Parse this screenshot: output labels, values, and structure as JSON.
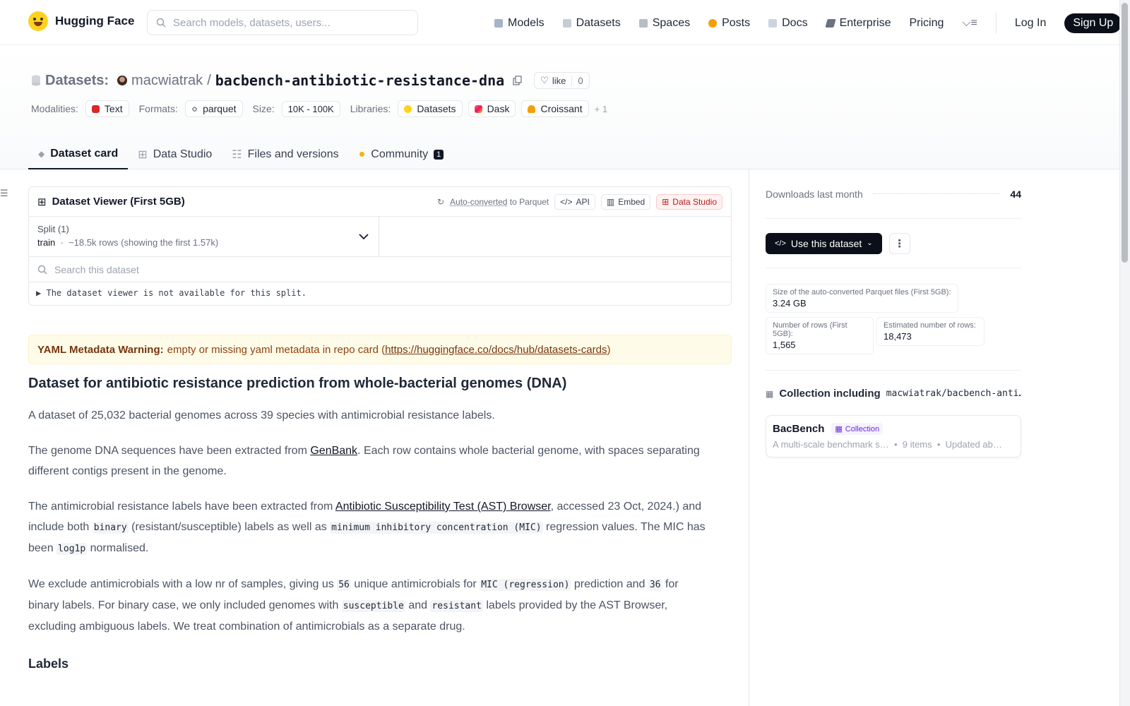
{
  "nav": {
    "brand": "Hugging Face",
    "search_placeholder": "Search models, datasets, users...",
    "links": [
      "Models",
      "Datasets",
      "Spaces",
      "Posts",
      "Docs",
      "Enterprise",
      "Pricing"
    ],
    "login": "Log In",
    "signup": "Sign Up"
  },
  "header": {
    "section_label": "Datasets:",
    "owner": "macwiatrak",
    "sep": "/",
    "name": "bacbench-antibiotic-resistance-dna",
    "like_label": "like",
    "like_count": "0",
    "tags": {
      "modalities_label": "Modalities:",
      "modality": "Text",
      "formats_label": "Formats:",
      "format": "parquet",
      "size_label": "Size:",
      "size": "10K - 100K",
      "libraries_label": "Libraries:",
      "libraries": [
        "Datasets",
        "Dask",
        "Croissant"
      ],
      "more": "+ 1"
    }
  },
  "tabs": {
    "dataset_card": "Dataset card",
    "data_studio": "Data Studio",
    "files": "Files and versions",
    "community": "Community",
    "community_count": "1"
  },
  "viewer": {
    "title": "Dataset Viewer (First 5GB)",
    "auto_converted": "Auto-converted",
    "to_parquet": " to Parquet",
    "api": "API",
    "embed": "Embed",
    "data_studio": "Data Studio",
    "split_title": "Split (1)",
    "split_name": "train",
    "split_rows": "~18.5k rows (showing the first 1.57k)",
    "search_placeholder": "Search this dataset",
    "note": "The dataset viewer is not available for this split."
  },
  "warning": {
    "label": "YAML Metadata Warning:",
    "text": "empty or missing yaml metadata in repo card (",
    "link": "https://huggingface.co/docs/hub/datasets-cards",
    "close": ")"
  },
  "card": {
    "heading": "Dataset for antibiotic resistance prediction from whole-bacterial genomes (DNA)",
    "p1": "A dataset of 25,032 bacterial genomes across 39 species with antimicrobial resistance labels.",
    "p2_a": "The genome DNA sequences have been extracted from ",
    "p2_link": "GenBank",
    "p2_b": ". Each row contains whole bacterial genome, with spaces separating different contigs present in the genome.",
    "p3_a": "The antimicrobial resistance labels have been extracted from ",
    "p3_link": "Antibiotic Susceptibility Test (AST) Browser",
    "p3_b": ", accessed 23 Oct, 2024.) and include both ",
    "p3_code1": "binary",
    "p3_c": " (resistant/susceptible) labels as well as ",
    "p3_code2": "minimum inhibitory concentration (MIC)",
    "p3_d": " regression values. The MIC has been ",
    "p3_code3": "log1p",
    "p3_e": " normalised.",
    "p4_a": "We exclude antimicrobials with a low nr of samples, giving us ",
    "p4_code1": "56",
    "p4_b": " unique antimicrobials for ",
    "p4_code2": "MIC (regression)",
    "p4_c": " prediction and ",
    "p4_code3": "36",
    "p4_d": " for binary labels. For binary case, we only included genomes with ",
    "p4_code4": "susceptible",
    "p4_e": " and ",
    "p4_code5": "resistant",
    "p4_f": " labels provided by the AST Browser, excluding ambiguous labels. We treat combination of antimicrobials as a separate drug.",
    "labels_heading": "Labels"
  },
  "sidebar": {
    "downloads_label": "Downloads last month",
    "downloads_value": "44",
    "use_button": "Use this dataset",
    "stats": [
      {
        "label": "Size of the auto-converted Parquet files (First 5GB):",
        "value": "3.24 GB"
      },
      {
        "label": "Number of rows (First 5GB):",
        "value": "1,565"
      },
      {
        "label": "Estimated number of rows:",
        "value": "18,473"
      }
    ],
    "collection_label": "Collection including",
    "collection_repo": "macwiatrak/bacbench-anti…",
    "collection_name": "BacBench",
    "collection_badge": "Collection",
    "collection_desc": "A multi-scale benchmark s…",
    "collection_items": "9 items",
    "collection_updated": "Updated ab…"
  },
  "colors": {
    "dark": "#0b0f19",
    "accent_yellow": "#ffd21e",
    "warning_bg": "#fefce8"
  }
}
